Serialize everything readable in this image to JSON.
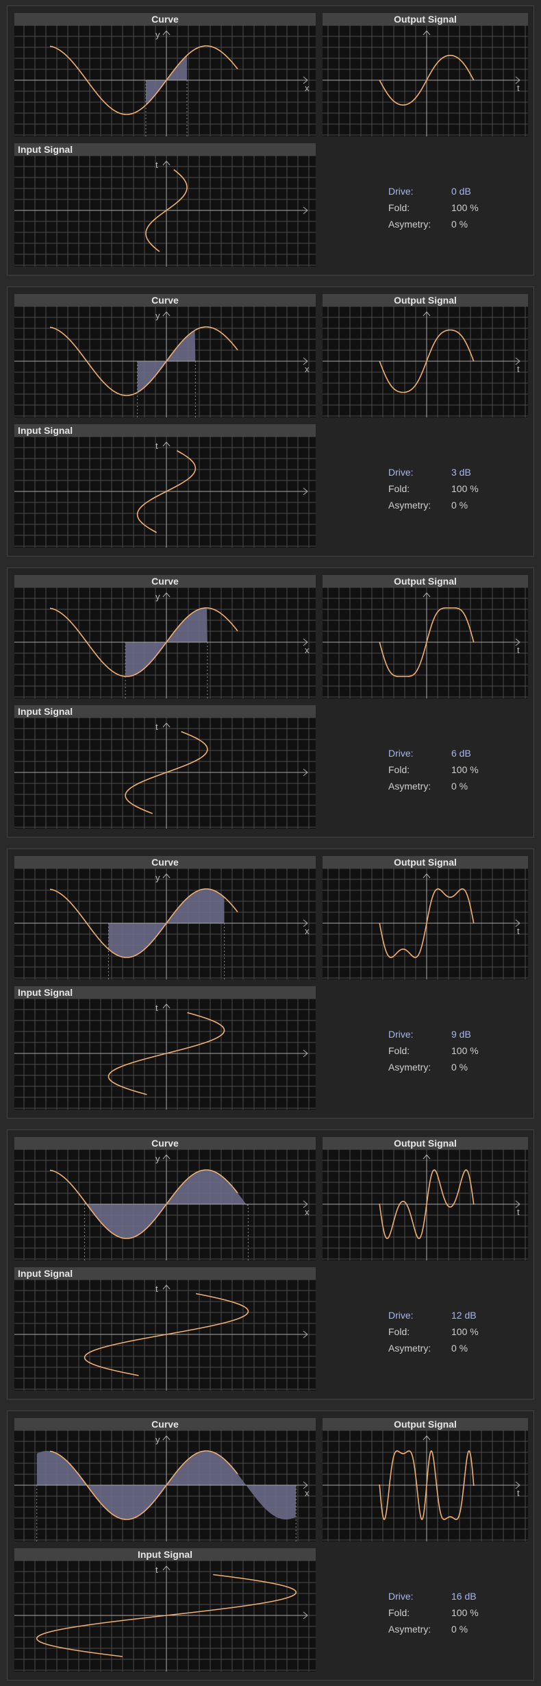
{
  "titles": {
    "curve": "Curve",
    "output": "Output Signal",
    "input": "Input Signal"
  },
  "axis_labels": {
    "x": "x",
    "y": "y",
    "t": "t"
  },
  "param_labels": {
    "drive": "Drive:",
    "fold": "Fold:",
    "asymmetry": "Asymetry:"
  },
  "colors": {
    "background": "#2a2a2a",
    "panel": "#242424",
    "plot_bg": "#111111",
    "grid": "#4a4a4a",
    "curve": "#f0b070",
    "fill": "#6a6a88",
    "drive_text": "#a9b6ee"
  },
  "panels": [
    {
      "drive": "0 dB",
      "fold": "100 %",
      "asymmetry": "0 %"
    },
    {
      "drive": "3 dB",
      "fold": "100 %",
      "asymmetry": "0 %"
    },
    {
      "drive": "6 dB",
      "fold": "100 %",
      "asymmetry": "0 %"
    },
    {
      "drive": "9 dB",
      "fold": "100 %",
      "asymmetry": "0 %"
    },
    {
      "drive": "12 dB",
      "fold": "100 %",
      "asymmetry": "0 %"
    },
    {
      "drive": "16 dB",
      "fold": "100 %",
      "asymmetry": "0 %"
    }
  ]
}
